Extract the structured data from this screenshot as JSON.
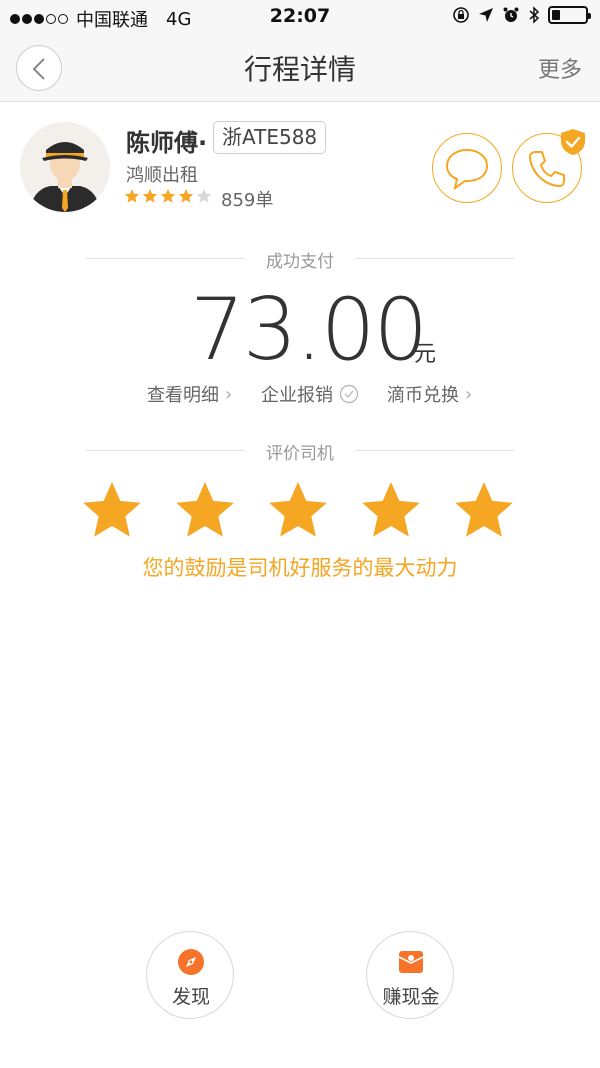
{
  "status_bar": {
    "carrier": "中国联通",
    "network": "4G",
    "time": "22:07",
    "signal_filled": 3,
    "signal_total": 5,
    "battery_level": 0.25
  },
  "nav": {
    "title": "行程详情",
    "more_label": "更多",
    "back_icon": "chevron-left-icon"
  },
  "driver": {
    "name": "陈师傅·",
    "plate": "浙ATE588",
    "company": "鸿顺出租",
    "rating_stars": 4,
    "rating_max": 5,
    "orders": "859单"
  },
  "payment": {
    "status_label": "成功支付",
    "amount": "73.00",
    "currency": "元",
    "links": {
      "detail": "查看明细",
      "expense": "企业报销",
      "coin": "滴币兑换"
    }
  },
  "rating": {
    "section_label": "评价司机",
    "star_count": 5,
    "encouragement": "您的鼓励是司机好服务的最大动力"
  },
  "bottom": {
    "discover_label": "发现",
    "earn_label": "赚现金"
  },
  "colors": {
    "accent": "#f5a623",
    "star_empty": "#d8d8d8",
    "text_primary": "#333333",
    "text_secondary": "#999999"
  }
}
